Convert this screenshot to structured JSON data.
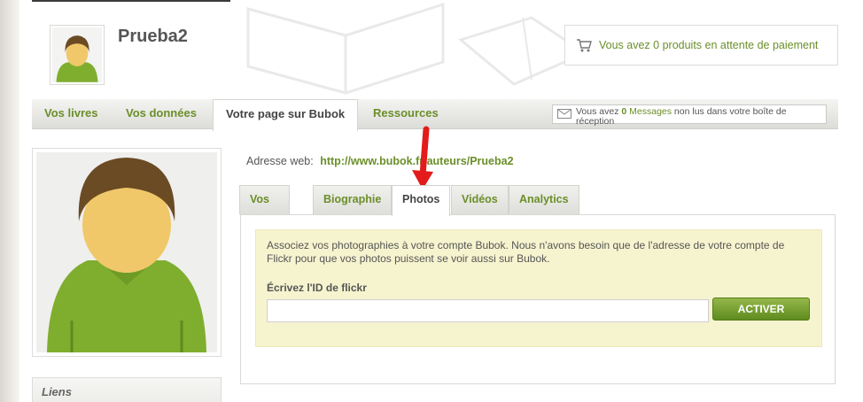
{
  "header": {
    "username": "Prueba2",
    "cart_text": "Vous avez 0 produits en attente de paiement"
  },
  "main_nav": {
    "items": [
      {
        "label": "Vos livres"
      },
      {
        "label": "Vos données"
      },
      {
        "label": "Votre page sur Bubok"
      },
      {
        "label": "Ressources"
      }
    ],
    "active": "Votre page sur Bubok"
  },
  "messages": {
    "prefix": "Vous avez",
    "count": "0",
    "link": "Messages",
    "suffix": "non lus dans votre boîte de réception"
  },
  "profile": {
    "web_address_label": "Adresse web:",
    "web_address_url": "http://www.bubok.fr/auteurs/Prueba2"
  },
  "sub_tabs": {
    "items": [
      {
        "label": "Vos livres"
      },
      {
        "label": "Biographie"
      },
      {
        "label": "Photos"
      },
      {
        "label": "Vidéos"
      },
      {
        "label": "Analytics"
      }
    ],
    "active": "Photos"
  },
  "photos": {
    "description": "Associez vos photographies à votre compte Bubok. Nous n'avons besoin que de l'adresse de votre compte de Flickr pour que vos photos puissent se voir aussi sur Bubok.",
    "flickr_label": "Écrivez l'ID de flickr",
    "flickr_value": "",
    "button_label": "ACTIVER"
  },
  "sidebar": {
    "links_title": "Liens"
  },
  "colors": {
    "accent_green": "#6b8f2a",
    "info_background": "#f6f4cf",
    "annotation_arrow": "#e31b1b"
  }
}
